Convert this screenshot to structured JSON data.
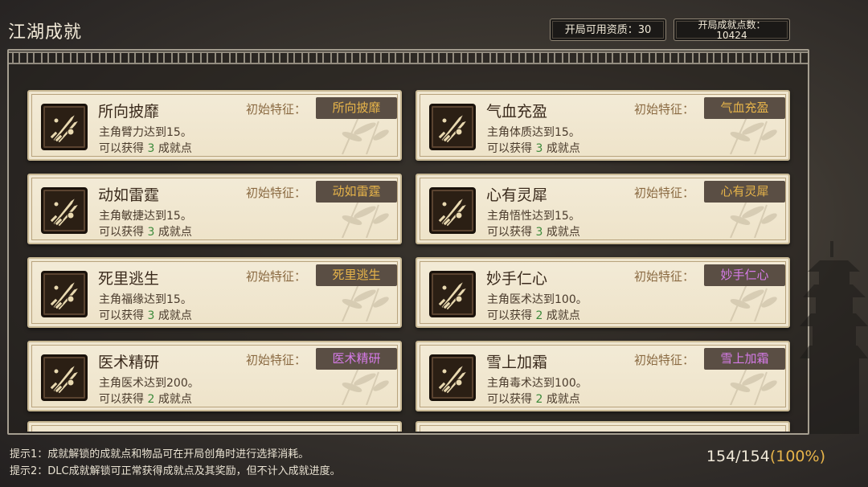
{
  "header": {
    "title": "江湖成就",
    "available_qualification_label": "开局可用资质：30",
    "achievement_points_label": "开局成就点数：",
    "achievement_points_value": "10424"
  },
  "trait_label": "初始特征：",
  "reward_prefix": "可以获得",
  "reward_suffix": "成就点",
  "achievements": [
    {
      "name": "所向披靡",
      "desc": "主角臂力达到15。",
      "points": "3",
      "trait": "所向披靡",
      "trait_color": "#e7b44a"
    },
    {
      "name": "气血充盈",
      "desc": "主角体质达到15。",
      "points": "3",
      "trait": "气血充盈",
      "trait_color": "#e7b44a"
    },
    {
      "name": "动如雷霆",
      "desc": "主角敏捷达到15。",
      "points": "3",
      "trait": "动如雷霆",
      "trait_color": "#e7b44a"
    },
    {
      "name": "心有灵犀",
      "desc": "主角悟性达到15。",
      "points": "3",
      "trait": "心有灵犀",
      "trait_color": "#e7b44a"
    },
    {
      "name": "死里逃生",
      "desc": "主角福缘达到15。",
      "points": "3",
      "trait": "死里逃生",
      "trait_color": "#e7b44a"
    },
    {
      "name": "妙手仁心",
      "desc": "主角医术达到100。",
      "points": "2",
      "trait": "妙手仁心",
      "trait_color": "#d67be8"
    },
    {
      "name": "医术精研",
      "desc": "主角医术达到200。",
      "points": "2",
      "trait": "医术精研",
      "trait_color": "#d67be8"
    },
    {
      "name": "雪上加霜",
      "desc": "主角毒术达到100。",
      "points": "2",
      "trait": "雪上加霜",
      "trait_color": "#d67be8"
    }
  ],
  "hints": [
    "提示1：成就解锁的成就点和物品可在开局创角时进行选择消耗。",
    "提示2：DLC成就解锁可正常获得成就点及其奖励，但不计入成就进度。"
  ],
  "progress": {
    "count": "154/154",
    "percent": "(100%)"
  }
}
